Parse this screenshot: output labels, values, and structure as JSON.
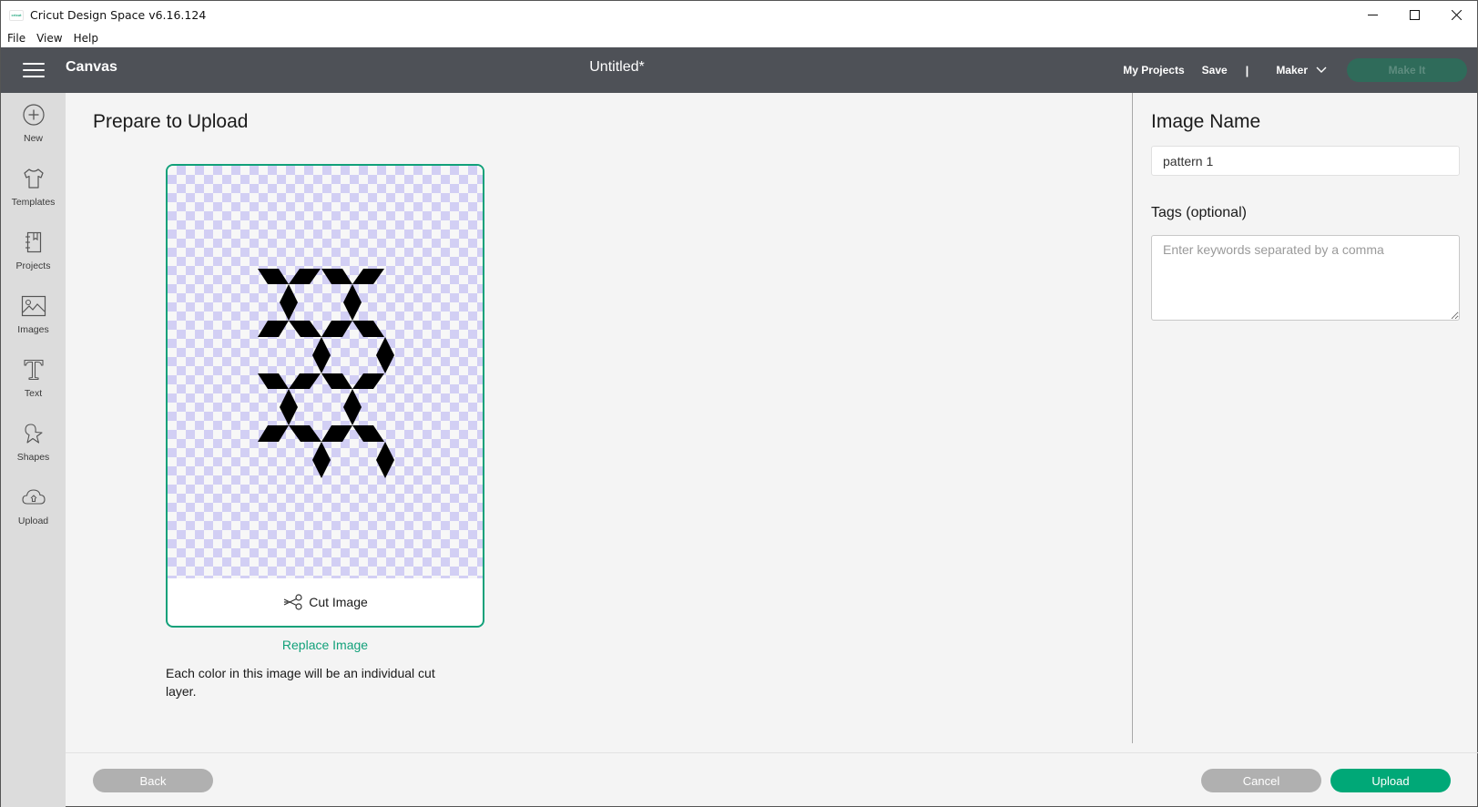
{
  "window": {
    "app_title": "Cricut Design Space  v6.16.124",
    "logo_text": "cricut",
    "controls": [
      "minimize",
      "maximize",
      "close"
    ]
  },
  "menu": [
    "File",
    "View",
    "Help"
  ],
  "header": {
    "section": "Canvas",
    "project_title": "Untitled*",
    "my_projects": "My Projects",
    "save": "Save",
    "separator": "|",
    "machine": "Maker",
    "make_it": "Make It"
  },
  "sidebar": {
    "items": [
      {
        "label": "New",
        "icon": "plus-circle-icon"
      },
      {
        "label": "Templates",
        "icon": "tshirt-icon"
      },
      {
        "label": "Projects",
        "icon": "notebook-icon"
      },
      {
        "label": "Images",
        "icon": "image-icon"
      },
      {
        "label": "Text",
        "icon": "text-t-icon"
      },
      {
        "label": "Shapes",
        "icon": "shapes-icon"
      },
      {
        "label": "Upload",
        "icon": "cloud-upload-icon"
      }
    ]
  },
  "main": {
    "title": "Prepare to Upload",
    "cut_option": "Cut Image",
    "replace_link": "Replace Image",
    "help_text": "Each color in this image will be an individual cut layer.",
    "preview": {
      "fill_color": "#000000",
      "checker_color": "#d2cff4"
    }
  },
  "right_panel": {
    "name_label": "Image Name",
    "name_value": "pattern 1",
    "tags_label": "Tags (optional)",
    "tags_placeholder": "Enter keywords separated by a comma",
    "tags_value": ""
  },
  "footer": {
    "back": "Back",
    "cancel": "Cancel",
    "upload": "Upload"
  },
  "colors": {
    "accent": "#12a17a",
    "primary_button": "#00a877",
    "header_bg": "#4e5157",
    "disabled_button": "#b0b0b0"
  }
}
